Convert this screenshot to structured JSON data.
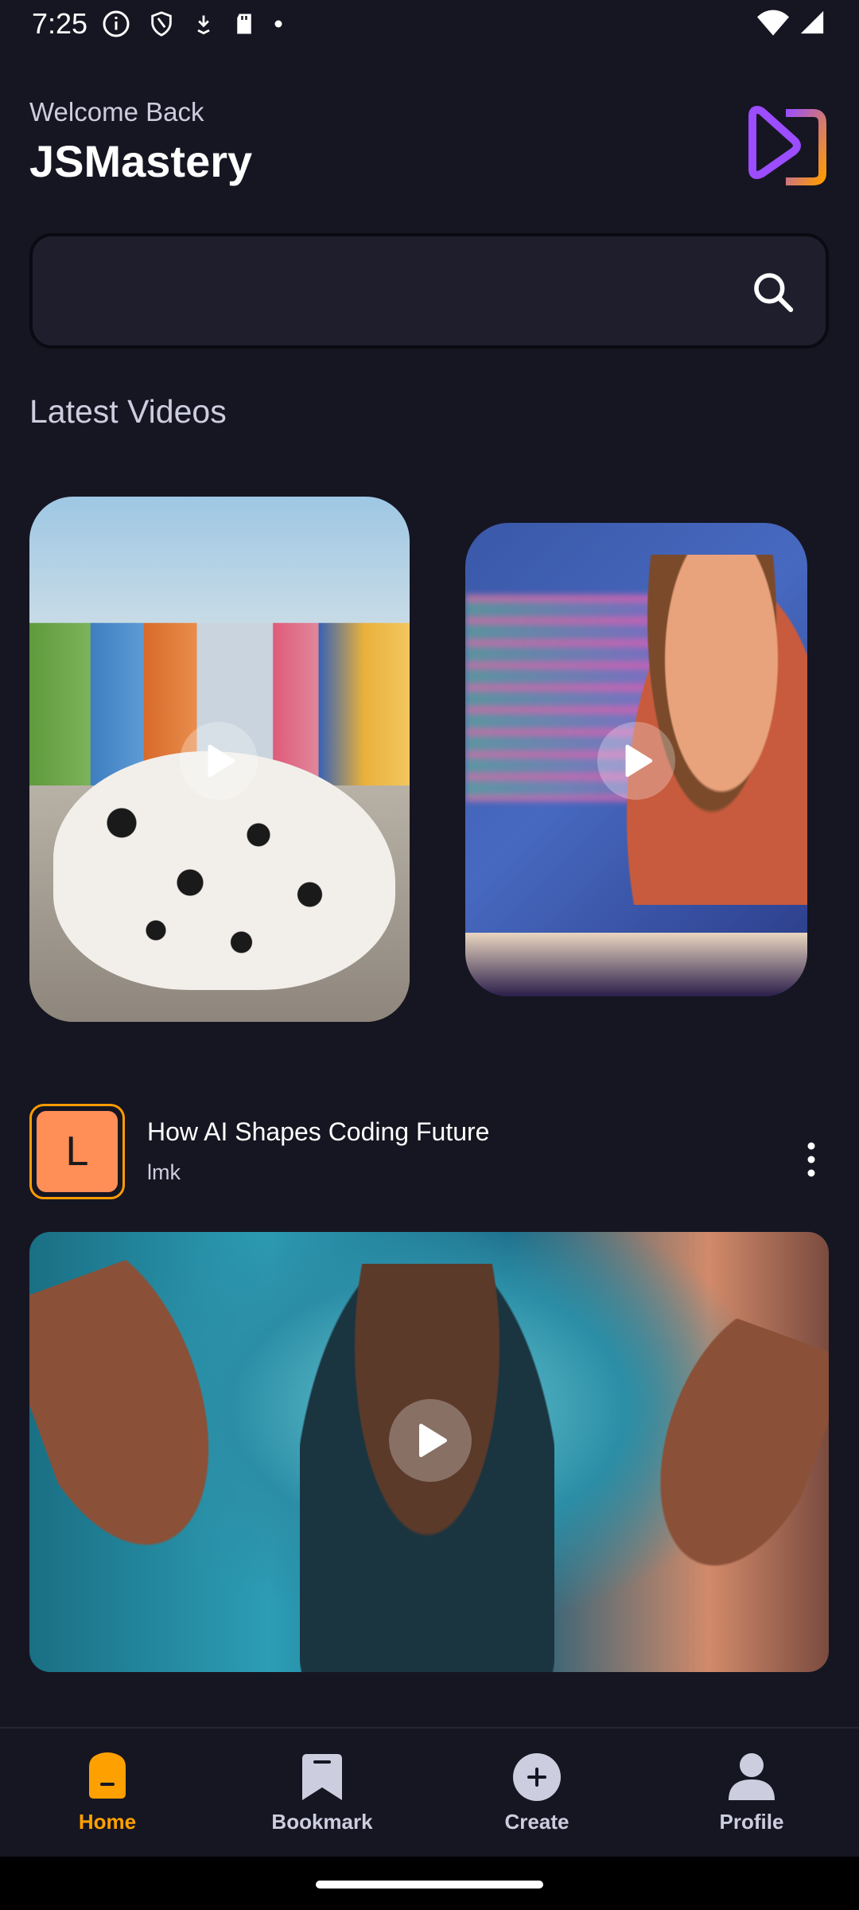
{
  "status_bar": {
    "time": "7:25",
    "icons_left": [
      "info-icon",
      "shield-icon",
      "download-icon",
      "sd-card-icon",
      "dot-icon"
    ],
    "icons_right": [
      "wifi-icon",
      "signal-icon"
    ]
  },
  "header": {
    "welcome": "Welcome Back",
    "username": "JSMastery",
    "logo_icon": "logo-icon"
  },
  "search": {
    "placeholder": "",
    "value": "",
    "icon": "search-icon"
  },
  "latest_videos": {
    "title": "Latest Videos",
    "items": [
      {
        "thumbnail": "dalmatian-street-image"
      },
      {
        "thumbnail": "coder-at-desk-image"
      }
    ]
  },
  "video": {
    "avatar_letter": "L",
    "title": "How AI Shapes Coding Future",
    "creator": "lmk",
    "thumbnail": "vr-headset-person-image"
  },
  "nav": {
    "items": [
      {
        "label": "Home",
        "icon": "home-icon",
        "active": true
      },
      {
        "label": "Bookmark",
        "icon": "bookmark-icon",
        "active": false
      },
      {
        "label": "Create",
        "icon": "plus-circle-icon",
        "active": false
      },
      {
        "label": "Profile",
        "icon": "profile-icon",
        "active": false
      }
    ]
  },
  "colors": {
    "background": "#161622",
    "accent": "#FFA001",
    "search_bg": "#1E1E2D",
    "text_secondary": "#CDCDE0",
    "avatar_bg": "#FF8E57"
  }
}
